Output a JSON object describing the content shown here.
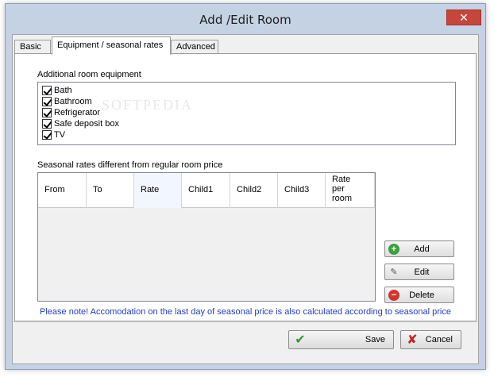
{
  "window": {
    "title": "Add /Edit Room",
    "close_glyph": "✕"
  },
  "tabs": [
    {
      "label": "Basic",
      "active": false
    },
    {
      "label": "Equipment / seasonal rates",
      "active": true
    },
    {
      "label": "Advanced",
      "active": false
    }
  ],
  "equipment": {
    "label": "Additional room equipment",
    "items": [
      {
        "label": "Bath",
        "checked": true
      },
      {
        "label": "Bathroom",
        "checked": true
      },
      {
        "label": "Refrigerator",
        "checked": true
      },
      {
        "label": "Safe deposit box",
        "checked": true
      },
      {
        "label": "TV",
        "checked": true
      }
    ]
  },
  "rates": {
    "label": "Seasonal rates different from regular room price",
    "columns": [
      "From",
      "To",
      "Rate",
      "Child1",
      "Child2",
      "Child3",
      "Rate per room"
    ],
    "columns_wrapped": {
      "rate_per_room": "Rate\nper\nroom"
    },
    "rows": []
  },
  "actions": {
    "add": {
      "label": "Add",
      "icon": "add-icon"
    },
    "edit": {
      "label": "Edit",
      "icon": "edit-icon"
    },
    "delete": {
      "label": "Delete",
      "icon": "delete-icon"
    }
  },
  "note": "Please note! Accomodation on the last day of seasonal price is also calculated according to seasonal price",
  "footer": {
    "save_label": "Save",
    "cancel_label": "Cancel"
  },
  "watermark": "SOFTPEDIA",
  "colors": {
    "note_text": "#1f3fbf",
    "close_button": "#c7463c",
    "frame": "#c4d2e4"
  }
}
